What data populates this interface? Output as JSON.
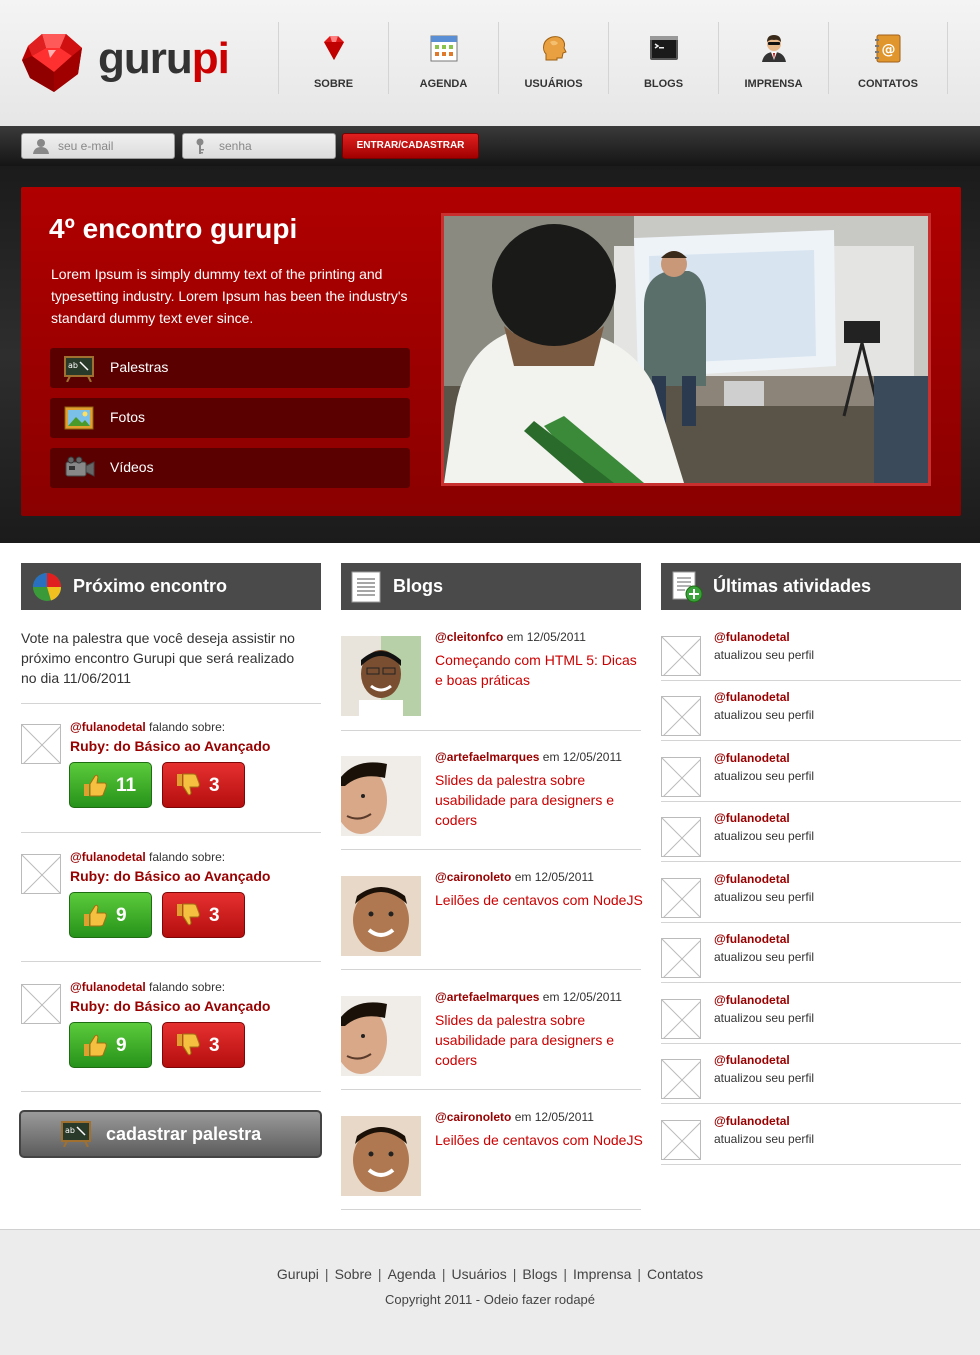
{
  "brand": {
    "name_part1": "guru",
    "name_part2": "pi",
    "accent": "#cc0000"
  },
  "nav": [
    {
      "label": "SOBRE",
      "icon": "ruby-icon"
    },
    {
      "label": "AGENDA",
      "icon": "calendar-icon"
    },
    {
      "label": "USUÁRIOS",
      "icon": "user-head-icon"
    },
    {
      "label": "BLOGS",
      "icon": "terminal-icon"
    },
    {
      "label": "IMPRENSA",
      "icon": "agent-icon"
    },
    {
      "label": "CONTATOS",
      "icon": "address-book-icon"
    }
  ],
  "login": {
    "email_placeholder": "seu e-mail",
    "password_placeholder": "senha",
    "submit_label": "ENTRAR/CADASTRAR"
  },
  "hero": {
    "title": "4º encontro gurupi",
    "text": "Lorem Ipsum is simply dummy text of the printing and typesetting industry. Lorem Ipsum has been the industry's standard dummy text ever since.",
    "links": [
      {
        "label": "Palestras",
        "icon": "chalkboard-icon"
      },
      {
        "label": "Fotos",
        "icon": "picture-icon"
      },
      {
        "label": "Vídeos",
        "icon": "video-camera-icon"
      }
    ]
  },
  "proximo": {
    "title": "Próximo encontro",
    "intro": "Vote na palestra que você deseja assistir no próximo encontro Gurupi que será realizado no dia 11/06/2011",
    "talks": [
      {
        "user": "@fulanodetal",
        "suffix": "falando sobre:",
        "title": "Ruby: do Básico ao Avançado",
        "up": "11",
        "down": "3"
      },
      {
        "user": "@fulanodetal",
        "suffix": "falando sobre:",
        "title": "Ruby: do Básico ao Avançado",
        "up": "9",
        "down": "3"
      },
      {
        "user": "@fulanodetal",
        "suffix": "falando sobre:",
        "title": "Ruby: do Básico ao Avançado",
        "up": "9",
        "down": "3"
      }
    ],
    "button_label": "cadastrar palestra"
  },
  "blogs": {
    "title": "Blogs",
    "posts": [
      {
        "user": "@cleitonfco",
        "date": "em 12/05/2011",
        "title": "Começando com HTML 5: Dicas e boas práticas"
      },
      {
        "user": "@artefaelmarques",
        "date": "em 12/05/2011",
        "title": "Slides da palestra sobre usabilidade para designers e coders"
      },
      {
        "user": "@caironoleto",
        "date": "em 12/05/2011",
        "title": "Leilões de centavos com NodeJS"
      },
      {
        "user": "@artefaelmarques",
        "date": "em 12/05/2011",
        "title": "Slides da palestra sobre usabilidade para designers e coders"
      },
      {
        "user": "@caironoleto",
        "date": "em 12/05/2011",
        "title": "Leilões de centavos com NodeJS"
      }
    ]
  },
  "atividades": {
    "title": "Últimas atividades",
    "items": [
      {
        "user": "@fulanodetal",
        "text": "atualizou seu perfil"
      },
      {
        "user": "@fulanodetal",
        "text": "atualizou seu perfil"
      },
      {
        "user": "@fulanodetal",
        "text": "atualizou seu perfil"
      },
      {
        "user": "@fulanodetal",
        "text": "atualizou seu perfil"
      },
      {
        "user": "@fulanodetal",
        "text": "atualizou seu perfil"
      },
      {
        "user": "@fulanodetal",
        "text": "atualizou seu perfil"
      },
      {
        "user": "@fulanodetal",
        "text": "atualizou seu perfil"
      },
      {
        "user": "@fulanodetal",
        "text": "atualizou seu perfil"
      },
      {
        "user": "@fulanodetal",
        "text": "atualizou seu perfil"
      }
    ]
  },
  "footer": {
    "links": [
      "Gurupi",
      "Sobre",
      "Agenda",
      "Usuários",
      "Blogs",
      "Imprensa",
      "Contatos"
    ],
    "separator": "|",
    "copyright": "Copyright 2011 - Odeio fazer rodapé"
  }
}
